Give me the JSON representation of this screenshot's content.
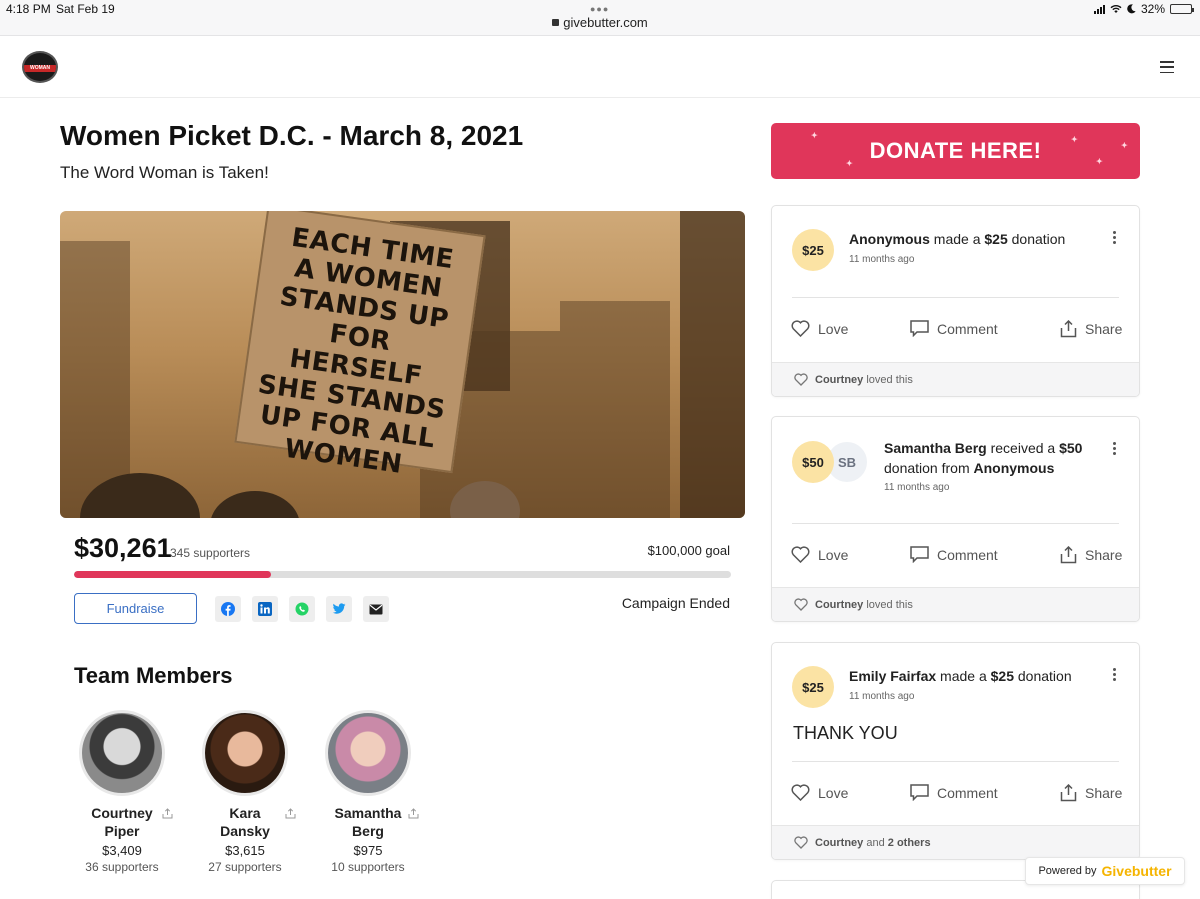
{
  "status_bar": {
    "time": "4:18 PM",
    "date": "Sat Feb 19",
    "url": "givebutter.com",
    "battery": "32%"
  },
  "header": {
    "logo_text": "WOMAN"
  },
  "campaign": {
    "title": "Women Picket D.C. - March 8, 2021",
    "subtitle": "The Word Woman is Taken!",
    "hero_sign_lines": [
      "EACH TIME",
      "A WOMEN",
      "STANDS UP",
      "FOR HERSELF",
      "SHE STANDS",
      "UP FOR ALL",
      "WOMEN"
    ],
    "raised": "$30,261",
    "supporters": "345 supporters",
    "goal": "$100,000 goal",
    "progress_fraction": 0.3,
    "fundraise_label": "Fundraise",
    "status": "Campaign Ended",
    "share_icons": [
      "facebook-icon",
      "linkedin-icon",
      "whatsapp-icon",
      "twitter-icon",
      "email-icon"
    ]
  },
  "team": {
    "title": "Team Members",
    "members": [
      {
        "first": "Courtney",
        "last": "Piper",
        "amount": "$3,409",
        "supporters": "36 supporters"
      },
      {
        "first": "Kara",
        "last": "Dansky",
        "amount": "$3,615",
        "supporters": "27 supporters"
      },
      {
        "first": "Samantha",
        "last": "Berg",
        "amount": "$975",
        "supporters": "10 supporters"
      }
    ]
  },
  "donate_label": "DONATE HERE!",
  "feed": [
    {
      "amount": "$25",
      "name": "Anonymous",
      "text_1": " made a ",
      "amount_inline": "$25",
      "text_2": " donation",
      "time": "11 months ago",
      "footer_name": "Courtney",
      "footer_text": "loved this"
    },
    {
      "amount": "$50",
      "initials": "SB",
      "name": "Samantha Berg",
      "text_1": " received a ",
      "amount_inline": "$50",
      "text_2": "donation from ",
      "from": "Anonymous",
      "time": "11 months ago",
      "footer_name": "Courtney",
      "footer_text": "loved this"
    },
    {
      "amount": "$25",
      "name": "Emily Fairfax",
      "text_1": " made a ",
      "amount_inline": "$25",
      "text_2": " donation",
      "time": "11 months ago",
      "message": "THANK YOU",
      "footer_name": "Courtney",
      "footer_text": "and",
      "footer_others": "2 others"
    }
  ],
  "actions": {
    "love": "Love",
    "comment": "Comment",
    "share": "Share"
  },
  "powered": {
    "prefix": "Powered by",
    "brand": "Givebutter"
  },
  "colors": {
    "accent": "#e0365a",
    "link": "#3a6fc4",
    "coin": "#fbe3a4",
    "brand": "#f5b400"
  }
}
